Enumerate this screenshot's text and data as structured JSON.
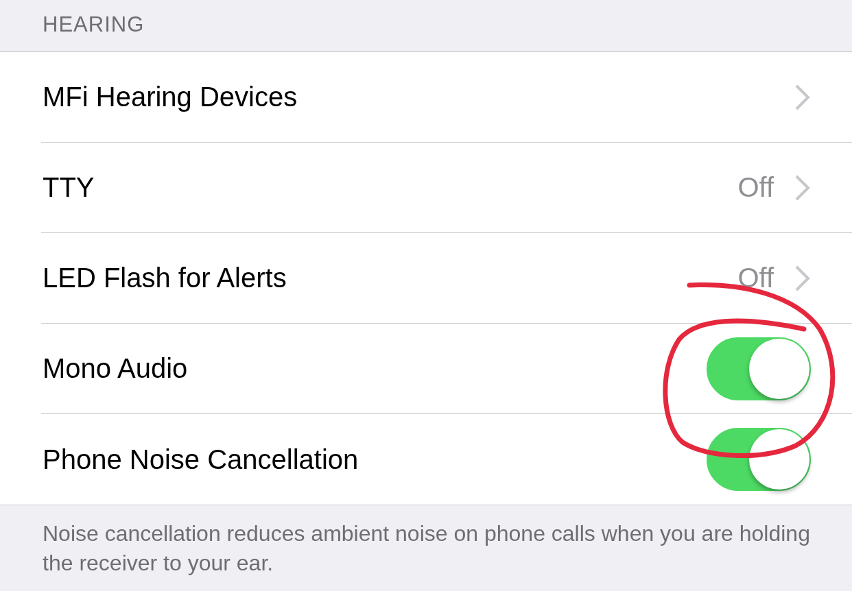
{
  "section_header": "HEARING",
  "rows": [
    {
      "kind": "link",
      "label": "MFi Hearing Devices"
    },
    {
      "kind": "link",
      "label": "TTY",
      "value": "Off"
    },
    {
      "kind": "link",
      "label": "LED Flash for Alerts",
      "value": "Off"
    },
    {
      "kind": "toggle",
      "label": "Mono Audio",
      "on": true
    },
    {
      "kind": "toggle",
      "label": "Phone Noise Cancellation",
      "on": true
    }
  ],
  "footer": "Noise cancellation reduces ambient noise on phone calls when you are holding the receiver to your ear.",
  "annotation": {
    "kind": "freehand-circle"
  }
}
